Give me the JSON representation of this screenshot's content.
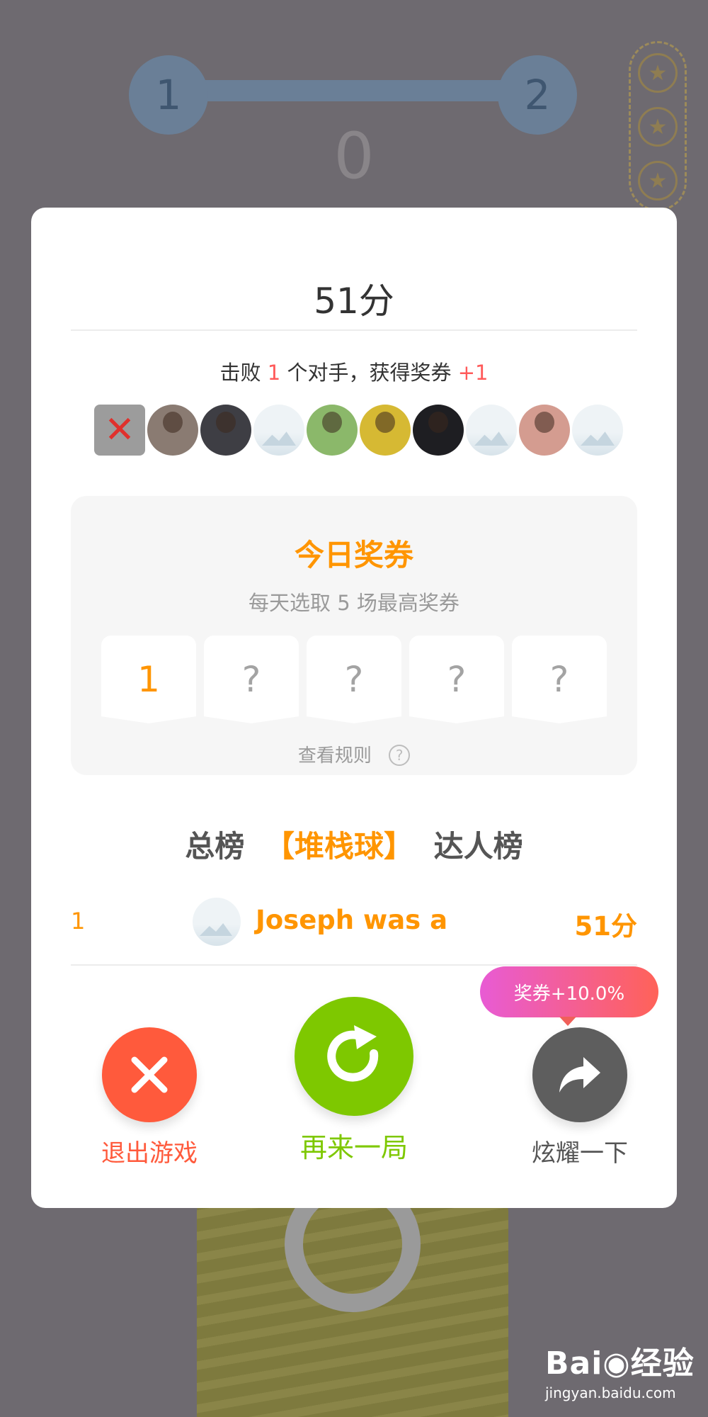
{
  "background": {
    "level_start": "1",
    "level_end": "2",
    "current_score": "0",
    "star_glyph": "★"
  },
  "result": {
    "score_text": "51分",
    "defeat_prefix": "击败",
    "defeat_count": "1",
    "defeat_middle": "个对手，获得奖券",
    "reward_delta": "+1",
    "opponent_count": 10,
    "defeated_mark": "✕"
  },
  "voucher": {
    "title": "今日奖券",
    "subtitle": "每天选取 5 场最高奖券",
    "slots": [
      "1",
      "?",
      "?",
      "?",
      "?"
    ],
    "rules_label": "查看规则",
    "rules_icon": "?"
  },
  "leaderboard": {
    "tabs": [
      "总榜",
      "【堆栈球】",
      "达人榜"
    ],
    "active_tab": "【堆栈球】",
    "rows": [
      {
        "rank": "1",
        "name": "Joseph was a",
        "score": "51分"
      }
    ]
  },
  "actions": {
    "exit_label": "退出游戏",
    "replay_label": "再来一局",
    "share_label": "炫耀一下",
    "share_bonus": "奖券+10.0%"
  },
  "watermark": {
    "logo": "Bai◉经验",
    "url": "jingyan.baidu.com"
  },
  "colors": {
    "accent_orange": "#ff9500",
    "exit_red": "#ff5a3c",
    "replay_green": "#7ec800",
    "share_gray": "#5e5e5e",
    "highlight_red": "#ff5a5a"
  }
}
